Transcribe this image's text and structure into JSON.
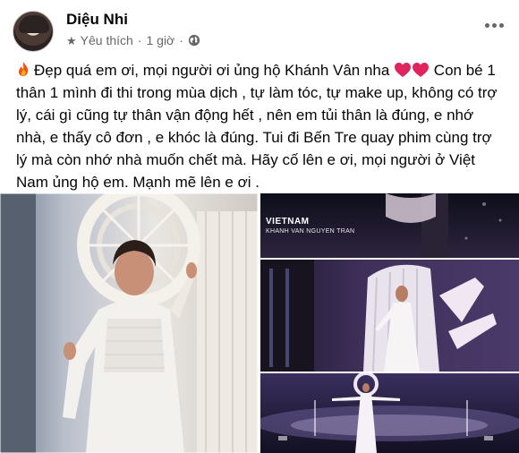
{
  "author": {
    "name": "Diệu Nhi"
  },
  "meta": {
    "reaction_label": "Yêu thích",
    "separator": "·",
    "time": "1 giờ"
  },
  "post": {
    "text": "Đẹp quá em ơi, mọi người ơi ủng hộ Khánh Vân nha",
    "text_cont": " Con bé 1 thân 1 mình đi thi trong mùa dịch , tự làm tóc, tự make up, không có trợ lý, cái gì cũng tự thân vận động hết , nên em tủi thân là đúng, e nhớ nhà, e thấy cô đơn , e khóc là đúng. Tui đi Bến Tre quay phim cùng trợ lý mà còn nhớ nhà muốn chết mà. Hãy cố lên e ơi, mọi người ở Việt Nam ủng hộ em. Mạnh mẽ lên e ơi ."
  },
  "photos": {
    "caption_country": "VIETNAM",
    "caption_name": "KHANH VAN NGUYEN TRAN"
  },
  "icons": {
    "star": "star-icon",
    "globe": "globe-icon",
    "more": "more-icon",
    "fire": "fire-emoji",
    "heart": "red-heart-emoji"
  },
  "colors": {
    "meta_gray": "#65676b",
    "heart_red": "#e0245e",
    "text": "#050505"
  }
}
